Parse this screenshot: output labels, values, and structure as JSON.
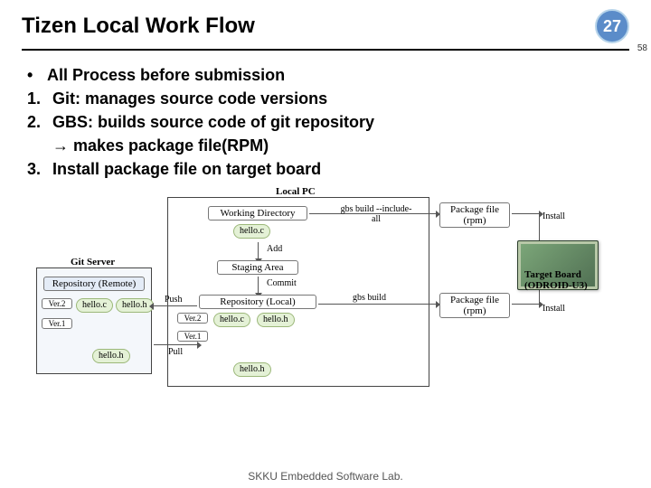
{
  "header": {
    "title": "Tizen Local Work Flow",
    "page_number": "27",
    "sub_page": "58"
  },
  "bullets": {
    "lead": "All Process before submission",
    "items": [
      "Git: manages source code versions",
      "GBS: builds source code of git repository",
      "→ makes package file(RPM)",
      "Install package file on target board"
    ],
    "nums": [
      "1.",
      "2.",
      "3."
    ]
  },
  "diagram": {
    "local_pc": "Local PC",
    "git_server": "Git Server",
    "working_dir": "Working Directory",
    "staging": "Staging Area",
    "repo_local": "Repository (Local)",
    "repo_remote": "Repository (Remote)",
    "pkg_file1": "Package file (rpm)",
    "pkg_file2": "Package file (rpm)",
    "add": "Add",
    "commit": "Commit",
    "push": "Push",
    "pull": "Pull",
    "gbs_all": "gbs build --include-all",
    "gbs": "gbs build",
    "install": "Install",
    "target": "Target Board (ODROID-U3)",
    "ver1": "Ver.1",
    "ver2": "Ver.2",
    "helloc": "hello.c",
    "helloh": "hello.h"
  },
  "footer": "SKKU Embedded Software Lab."
}
